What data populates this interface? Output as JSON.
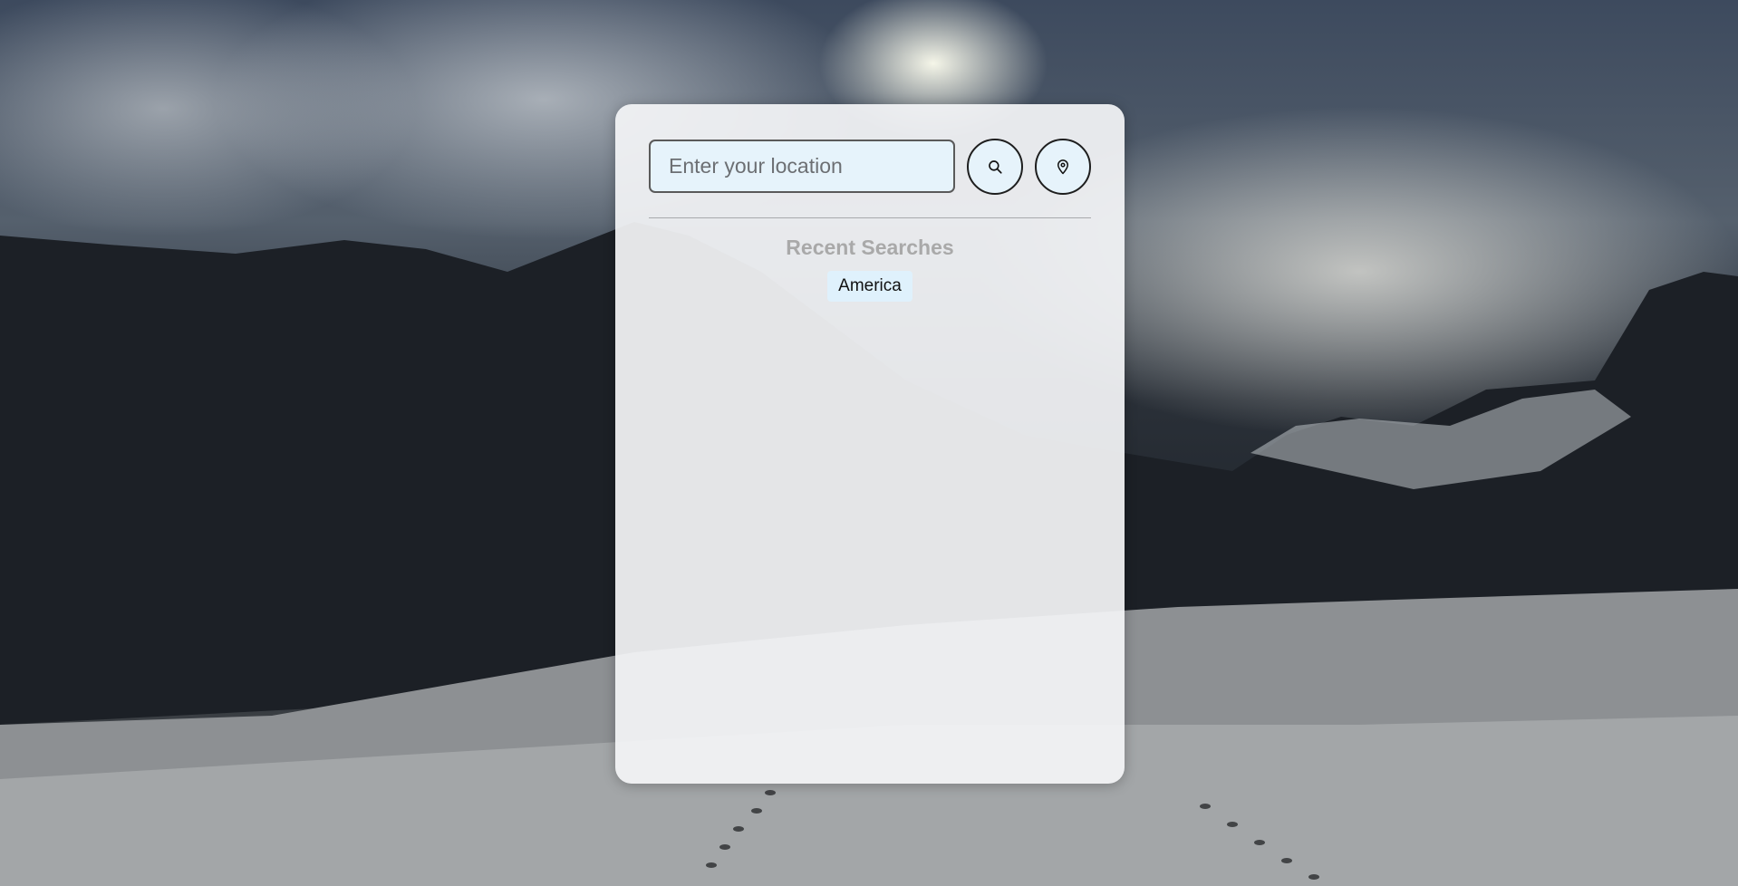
{
  "search": {
    "placeholder": "Enter your location",
    "value": "",
    "search_button_icon": "search-icon",
    "location_button_icon": "map-pin-icon"
  },
  "recent": {
    "title": "Recent Searches",
    "items": [
      "America"
    ]
  },
  "colors": {
    "panel_background": "#f3f4f6",
    "input_background": "#e6f3fb",
    "chip_background": "#dff1fc",
    "recent_title": "#a9a9a9"
  }
}
